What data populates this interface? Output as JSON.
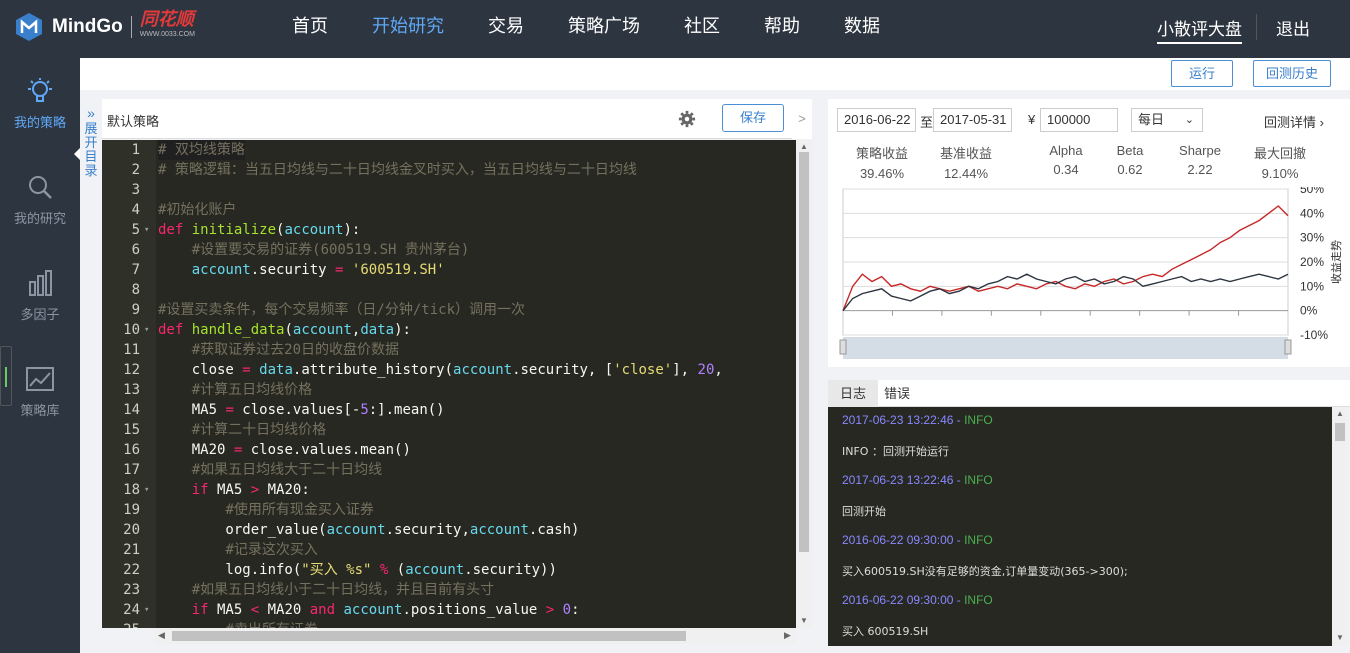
{
  "brand": {
    "name": "MindGo",
    "partner": "同花顺",
    "partner_url": "WWW.0033.COM"
  },
  "nav": [
    "首页",
    "开始研究",
    "交易",
    "策略广场",
    "社区",
    "帮助",
    "数据"
  ],
  "nav_active": 1,
  "user": {
    "name": "小散评大盘",
    "logout": "退出"
  },
  "sidebar": {
    "items": [
      {
        "label": "我的策略",
        "icon": "lightbulb-icon"
      },
      {
        "label": "我的研究",
        "icon": "magnifier-icon"
      },
      {
        "label": "多因子",
        "icon": "bar-chart-icon"
      },
      {
        "label": "策略库",
        "icon": "chart-library-icon"
      }
    ]
  },
  "toolbar": {
    "run": "运行",
    "history": "回测历史"
  },
  "expand_label": "展开目录",
  "editor": {
    "title": "默认策略",
    "save": "保存",
    "collapse": ">",
    "lines": [
      {
        "n": "1",
        "text": "# 双均线策略"
      },
      {
        "n": "2",
        "text": "# 策略逻辑：当五日均线与二十日均线金叉时买入，当五日均线与二十日均线"
      },
      {
        "n": "3",
        "text": ""
      },
      {
        "n": "4",
        "text": "#初始化账户"
      },
      {
        "n": "5",
        "text": "def initialize(account):"
      },
      {
        "n": "6",
        "text": "    #设置要交易的证券(600519.SH 贵州茅台)"
      },
      {
        "n": "7",
        "text": "    account.security = '600519.SH'"
      },
      {
        "n": "8",
        "text": ""
      },
      {
        "n": "9",
        "text": "#设置买卖条件，每个交易频率（日/分钟/tick）调用一次"
      },
      {
        "n": "10",
        "text": "def handle_data(account,data):"
      },
      {
        "n": "11",
        "text": "    #获取证券过去20日的收盘价数据"
      },
      {
        "n": "12",
        "text": "    close = data.attribute_history(account.security, ['close'], 20,"
      },
      {
        "n": "13",
        "text": "    #计算五日均线价格"
      },
      {
        "n": "14",
        "text": "    MA5 = close.values[-5:].mean()"
      },
      {
        "n": "15",
        "text": "    #计算二十日均线价格"
      },
      {
        "n": "16",
        "text": "    MA20 = close.values.mean()"
      },
      {
        "n": "17",
        "text": "    #如果五日均线大于二十日均线"
      },
      {
        "n": "18",
        "text": "    if MA5 > MA20:"
      },
      {
        "n": "19",
        "text": "        #使用所有现金买入证券"
      },
      {
        "n": "20",
        "text": "        order_value(account.security,account.cash)"
      },
      {
        "n": "21",
        "text": "        #记录这次买入"
      },
      {
        "n": "22",
        "text": "        log.info(\"买入 %s\" % (account.security))"
      },
      {
        "n": "23",
        "text": "    #如果五日均线小于二十日均线，并且目前有头寸"
      },
      {
        "n": "24",
        "text": "    if MA5 < MA20 and account.positions_value > 0:"
      },
      {
        "n": "25",
        "text": "        #卖出所有证券"
      }
    ]
  },
  "backtest": {
    "start": "2016-06-22",
    "to": "至",
    "end": "2017-05-31",
    "currency": "¥",
    "capital": "100000",
    "freq": "每日",
    "details": "回测详情",
    "stats": [
      {
        "label": "策略收益",
        "value": "39.46%"
      },
      {
        "label": "基准收益",
        "value": "12.44%"
      },
      {
        "label": "Alpha",
        "value": "0.34"
      },
      {
        "label": "Beta",
        "value": "0.62"
      },
      {
        "label": "Sharpe",
        "value": "2.22"
      },
      {
        "label": "最大回撤",
        "value": "9.10%"
      }
    ],
    "y_axis_title": "收益走势"
  },
  "chart_data": {
    "type": "line",
    "ylim": [
      -10,
      50
    ],
    "yticks": [
      "50%",
      "40%",
      "30%",
      "20%",
      "10%",
      "0%",
      "-10%"
    ],
    "grid": true,
    "series": [
      {
        "color": "#c62828",
        "values": [
          0,
          10,
          15,
          12,
          14,
          10,
          11,
          9,
          8,
          10,
          9,
          8,
          9,
          10,
          8,
          9,
          10,
          9,
          11,
          10,
          9,
          11,
          12,
          10,
          9,
          11,
          10,
          12,
          13,
          11,
          12,
          14,
          15,
          14,
          17,
          19,
          21,
          23,
          25,
          28,
          30,
          33,
          35,
          37,
          40,
          43,
          39
        ]
      },
      {
        "color": "#2d3540",
        "values": [
          0,
          5,
          7,
          8,
          9,
          6,
          5,
          4,
          6,
          8,
          9,
          7,
          8,
          10,
          9,
          11,
          12,
          14,
          13,
          15,
          13,
          12,
          11,
          13,
          14,
          12,
          13,
          11,
          12,
          14,
          13,
          10,
          11,
          12,
          13,
          14,
          12,
          13,
          12,
          13,
          12,
          13,
          14,
          15,
          14,
          13,
          15
        ]
      }
    ],
    "navigator_range": [
      0,
      1
    ]
  },
  "log": {
    "tabs": [
      "日志",
      "错误"
    ],
    "entries": [
      {
        "time": "2017-06-23 13:22:46",
        "level": "INFO",
        "msg": "INFO ：回测开始运行"
      },
      {
        "time": "2017-06-23 13:22:46",
        "level": "INFO",
        "msg": "回测开始"
      },
      {
        "time": "2016-06-22 09:30:00",
        "level": "INFO",
        "msg": "买入600519.SH没有足够的资金,订单量变动(365->300);"
      },
      {
        "time": "2016-06-22 09:30:00",
        "level": "INFO",
        "msg": "买入 600519.SH"
      }
    ]
  }
}
